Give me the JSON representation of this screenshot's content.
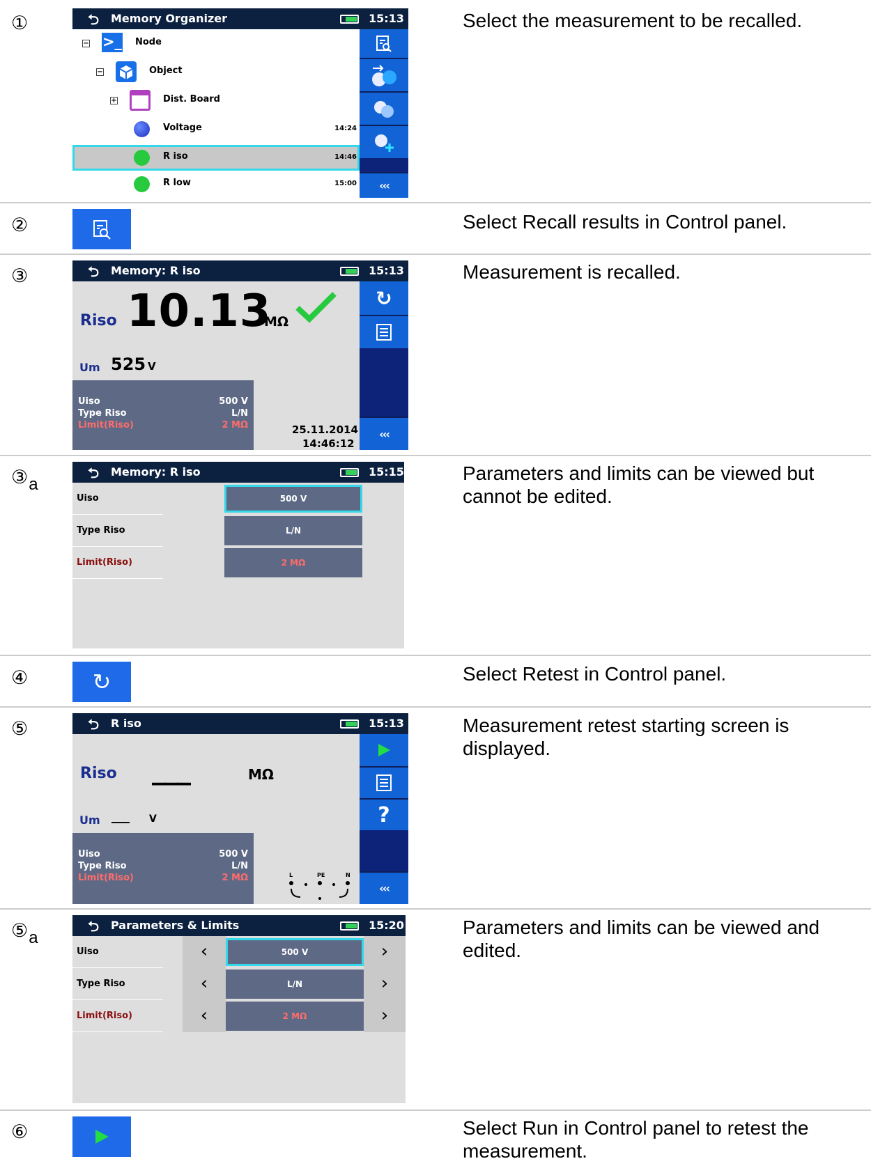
{
  "steps": [
    {
      "num": "①",
      "sub": "",
      "desc": "Select the measurement to be recalled."
    },
    {
      "num": "②",
      "sub": "",
      "desc": "Select Recall results in Control panel."
    },
    {
      "num": "③",
      "sub": "",
      "desc": "Measurement is recalled."
    },
    {
      "num": "③",
      "sub": "a",
      "desc": "Parameters and limits can be viewed but cannot be edited."
    },
    {
      "num": "④",
      "sub": "",
      "desc": "Select Retest in Control panel."
    },
    {
      "num": "⑤",
      "sub": "",
      "desc": "Measurement retest starting screen is displayed."
    },
    {
      "num": "⑤",
      "sub": "a",
      "desc": "Parameters and limits can be viewed and edited."
    },
    {
      "num": "⑥",
      "sub": "",
      "desc": "Select Run in Control panel to retest the measurement."
    }
  ],
  "s1": {
    "title": "Memory Organizer",
    "time": "15:13",
    "tree": [
      {
        "label": "Node",
        "time": ""
      },
      {
        "label": "Object",
        "time": ""
      },
      {
        "label": "Dist. Board",
        "time": ""
      },
      {
        "label": "Voltage",
        "time": "14:24"
      },
      {
        "label": "R iso",
        "time": "14:46"
      },
      {
        "label": "R low",
        "time": "15:00"
      }
    ],
    "more": "‹‹‹"
  },
  "s3": {
    "title": "Memory: R iso",
    "time": "15:13",
    "main_label": "Riso",
    "main_value": "10.13",
    "main_unit": "MΩ",
    "sub_label": "Um",
    "sub_value": "525",
    "sub_unit": "V",
    "params": [
      {
        "name": "Uiso",
        "value": "500 V"
      },
      {
        "name": "Type Riso",
        "value": "L/N"
      },
      {
        "name": "Limit(Riso)",
        "value": "2 MΩ"
      }
    ],
    "date": "25.11.2014",
    "clock": "14:46:12",
    "more": "‹‹‹"
  },
  "s3a": {
    "title": "Memory: R iso",
    "time": "15:15",
    "rows": [
      {
        "name": "Uiso",
        "value": "500 V"
      },
      {
        "name": "Type Riso",
        "value": "L/N"
      },
      {
        "name": "Limit(Riso)",
        "value": "2 MΩ"
      }
    ]
  },
  "s5": {
    "title": "R iso",
    "time": "15:13",
    "main_label": "Riso",
    "main_dash": "___",
    "main_unit": "MΩ",
    "sub_label": "Um",
    "sub_dash": "___",
    "sub_unit": "V",
    "params": [
      {
        "name": "Uiso",
        "value": "500 V"
      },
      {
        "name": "Type Riso",
        "value": "L/N"
      },
      {
        "name": "Limit(Riso)",
        "value": "2 MΩ"
      }
    ],
    "term_l": "L",
    "term_pe": "PE",
    "term_n": "N",
    "help": "?",
    "more": "‹‹‹"
  },
  "s5a": {
    "title": "Parameters & Limits",
    "time": "15:20",
    "rows": [
      {
        "name": "Uiso",
        "value": "500 V"
      },
      {
        "name": "Type Riso",
        "value": "L/N"
      },
      {
        "name": "Limit(Riso)",
        "value": "2 MΩ"
      }
    ]
  },
  "colors": {
    "title_bar": "#0c2040",
    "panel_button": "#1264d6",
    "panel_bg": "#0d237a",
    "highlight": "#34d8e8",
    "pass_green": "#27c93f",
    "limit_red": "#ff6c6c"
  }
}
